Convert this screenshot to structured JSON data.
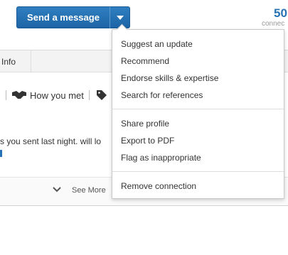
{
  "header": {
    "send_button_label": "Send a message",
    "connections_count": "50",
    "connections_label": "connec"
  },
  "card": {
    "tab_info_label": "Info",
    "how_you_met_label": "How you met",
    "message_preview": "s you sent last night. will lo",
    "see_more_label": "See More"
  },
  "dropdown": {
    "groups": [
      [
        "Suggest an update",
        "Recommend",
        "Endorse skills & expertise",
        "Search for references"
      ],
      [
        "Share profile",
        "Export to PDF",
        "Flag as inappropriate"
      ],
      [
        "Remove connection"
      ]
    ]
  },
  "colors": {
    "button_blue": "#2072b5",
    "link_blue": "#2672b5"
  },
  "icons": [
    "chevron-down-icon",
    "handshake-icon",
    "tag-icon"
  ]
}
